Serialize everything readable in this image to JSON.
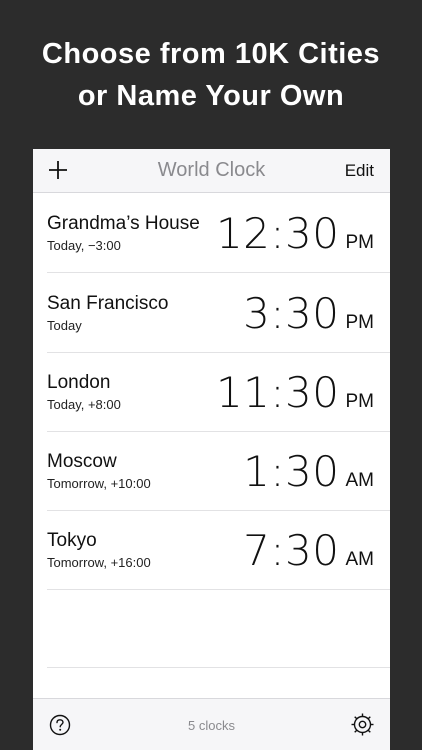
{
  "promo": {
    "line1": "Choose from 10K Cities",
    "line2": "or Name Your Own"
  },
  "navbar": {
    "title": "World Clock",
    "edit_label": "Edit",
    "add_icon": "plus-icon"
  },
  "clocks": [
    {
      "city": "Grandma’s House",
      "sub": "Today, −3:00",
      "time": "12:30",
      "ampm": "PM"
    },
    {
      "city": "San Francisco",
      "sub": "Today",
      "time": "3:30",
      "ampm": "PM"
    },
    {
      "city": "London",
      "sub": "Today, +8:00",
      "time": "11:30",
      "ampm": "PM"
    },
    {
      "city": "Moscow",
      "sub": "Tomorrow, +10:00",
      "time": "1:30",
      "ampm": "AM"
    },
    {
      "city": "Tokyo",
      "sub": "Tomorrow, +16:00",
      "time": "7:30",
      "ampm": "AM"
    }
  ],
  "toolbar": {
    "count_label": "5 clocks",
    "help_icon": "question-circle-icon",
    "settings_icon": "gear-icon"
  }
}
